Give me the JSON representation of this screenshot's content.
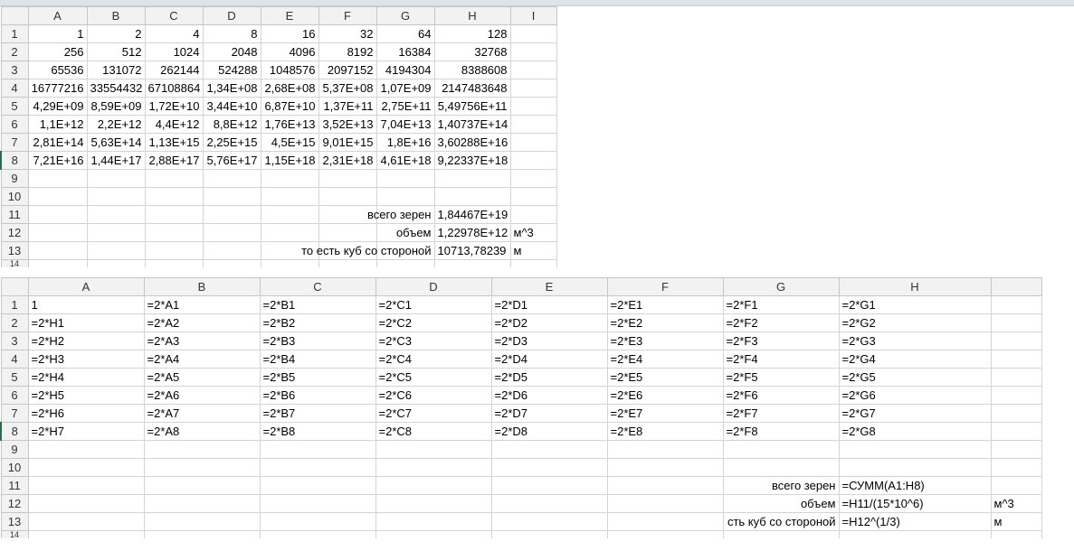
{
  "values_sheet": {
    "columns": [
      "A",
      "B",
      "C",
      "D",
      "E",
      "F",
      "G",
      "H",
      "I"
    ],
    "rows": [
      {
        "n": "1",
        "cells": [
          "1",
          "2",
          "4",
          "8",
          "16",
          "32",
          "64",
          "128",
          ""
        ]
      },
      {
        "n": "2",
        "cells": [
          "256",
          "512",
          "1024",
          "2048",
          "4096",
          "8192",
          "16384",
          "32768",
          ""
        ]
      },
      {
        "n": "3",
        "cells": [
          "65536",
          "131072",
          "262144",
          "524288",
          "1048576",
          "2097152",
          "4194304",
          "8388608",
          ""
        ]
      },
      {
        "n": "4",
        "cells": [
          "16777216",
          "33554432",
          "67108864",
          "1,34E+08",
          "2,68E+08",
          "5,37E+08",
          "1,07E+09",
          "2147483648",
          ""
        ]
      },
      {
        "n": "5",
        "cells": [
          "4,29E+09",
          "8,59E+09",
          "1,72E+10",
          "3,44E+10",
          "6,87E+10",
          "1,37E+11",
          "2,75E+11",
          "5,49756E+11",
          ""
        ]
      },
      {
        "n": "6",
        "cells": [
          "1,1E+12",
          "2,2E+12",
          "4,4E+12",
          "8,8E+12",
          "1,76E+13",
          "3,52E+13",
          "7,04E+13",
          "1,40737E+14",
          ""
        ]
      },
      {
        "n": "7",
        "cells": [
          "2,81E+14",
          "5,63E+14",
          "1,13E+15",
          "2,25E+15",
          "4,5E+15",
          "9,01E+15",
          "1,8E+16",
          "3,60288E+16",
          ""
        ]
      },
      {
        "n": "8",
        "cells": [
          "7,21E+16",
          "1,44E+17",
          "2,88E+17",
          "5,76E+17",
          "1,15E+18",
          "2,31E+18",
          "4,61E+18",
          "9,22337E+18",
          ""
        ]
      },
      {
        "n": "9",
        "cells": [
          "",
          "",
          "",
          "",
          "",
          "",
          "",
          "",
          ""
        ]
      },
      {
        "n": "10",
        "cells": [
          "",
          "",
          "",
          "",
          "",
          "",
          "",
          "",
          ""
        ]
      }
    ],
    "summary": [
      {
        "n": "11",
        "label": "всего зерен",
        "value": "1,84467E+19",
        "unit": ""
      },
      {
        "n": "12",
        "label": "объем",
        "value": "1,22978E+12",
        "unit": "м^3"
      },
      {
        "n": "13",
        "label": "то есть куб со стороной",
        "value": "10713,78239",
        "unit": "м"
      }
    ],
    "last_row": "14"
  },
  "formulas_sheet": {
    "columns": [
      "A",
      "B",
      "C",
      "D",
      "E",
      "F",
      "G",
      "H"
    ],
    "rows": [
      {
        "n": "1",
        "cells": [
          "1",
          "=2*A1",
          "=2*B1",
          "=2*C1",
          "=2*D1",
          "=2*E1",
          "=2*F1",
          "=2*G1"
        ]
      },
      {
        "n": "2",
        "cells": [
          "=2*H1",
          "=2*A2",
          "=2*B2",
          "=2*C2",
          "=2*D2",
          "=2*E2",
          "=2*F2",
          "=2*G2"
        ]
      },
      {
        "n": "3",
        "cells": [
          "=2*H2",
          "=2*A3",
          "=2*B3",
          "=2*C3",
          "=2*D3",
          "=2*E3",
          "=2*F3",
          "=2*G3"
        ]
      },
      {
        "n": "4",
        "cells": [
          "=2*H3",
          "=2*A4",
          "=2*B4",
          "=2*C4",
          "=2*D4",
          "=2*E4",
          "=2*F4",
          "=2*G4"
        ]
      },
      {
        "n": "5",
        "cells": [
          "=2*H4",
          "=2*A5",
          "=2*B5",
          "=2*C5",
          "=2*D5",
          "=2*E5",
          "=2*F5",
          "=2*G5"
        ]
      },
      {
        "n": "6",
        "cells": [
          "=2*H5",
          "=2*A6",
          "=2*B6",
          "=2*C6",
          "=2*D6",
          "=2*E6",
          "=2*F6",
          "=2*G6"
        ]
      },
      {
        "n": "7",
        "cells": [
          "=2*H6",
          "=2*A7",
          "=2*B7",
          "=2*C7",
          "=2*D7",
          "=2*E7",
          "=2*F7",
          "=2*G7"
        ]
      },
      {
        "n": "8",
        "cells": [
          "=2*H7",
          "=2*A8",
          "=2*B8",
          "=2*C8",
          "=2*D8",
          "=2*E8",
          "=2*F8",
          "=2*G8"
        ]
      },
      {
        "n": "9",
        "cells": [
          "",
          "",
          "",
          "",
          "",
          "",
          "",
          ""
        ]
      },
      {
        "n": "10",
        "cells": [
          "",
          "",
          "",
          "",
          "",
          "",
          "",
          ""
        ]
      }
    ],
    "summary": [
      {
        "n": "11",
        "label": "всего зерен",
        "value": "=СУММ(A1:H8)",
        "unit": ""
      },
      {
        "n": "12",
        "label": "объем",
        "value": "=H11/(15*10^6)",
        "unit": "м^3"
      },
      {
        "n": "13",
        "label": "сть куб со стороной",
        "value": "=H12^(1/3)",
        "unit": "м"
      }
    ],
    "last_row": "14"
  },
  "colors": {
    "header_bg": "#f2f2f2",
    "grid": "#d4d4d4",
    "selection": "#217346"
  }
}
